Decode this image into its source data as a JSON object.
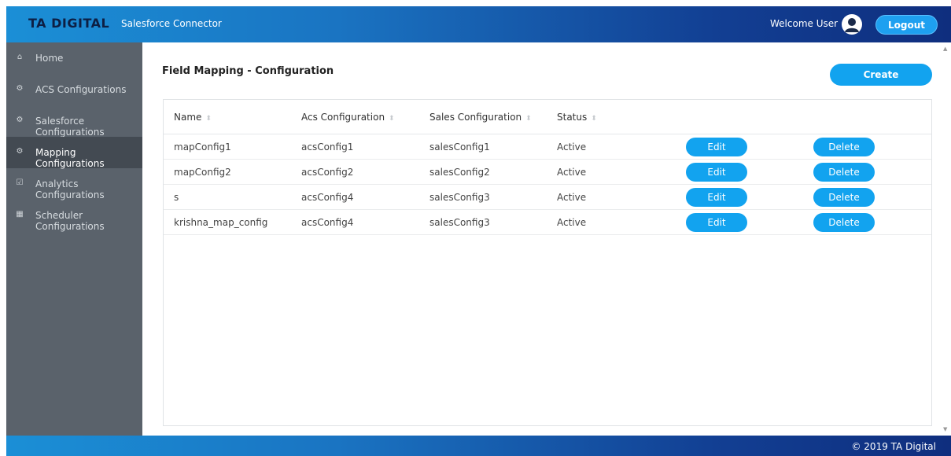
{
  "header": {
    "brand": "TA DIGITAL",
    "app_title": "Salesforce Connector",
    "welcome": "Welcome User",
    "logout_label": "Logout"
  },
  "sidebar": {
    "items": [
      {
        "label": "Home",
        "icon": "home-icon"
      },
      {
        "label": "ACS Configurations",
        "icon": "cogs-icon"
      },
      {
        "label": "Salesforce Configurations",
        "icon": "cogs-icon"
      },
      {
        "label": "Mapping Configurations",
        "icon": "cogs-icon",
        "active": true
      },
      {
        "label": "Analytics Configurations",
        "icon": "checkbox-icon"
      },
      {
        "label": "Scheduler Configurations",
        "icon": "calendar-icon"
      }
    ]
  },
  "main": {
    "title": "Field Mapping - Configuration",
    "create_label": "Create",
    "table": {
      "columns": [
        "Name",
        "Acs Configuration",
        "Sales Configuration",
        "Status"
      ],
      "edit_label": "Edit",
      "delete_label": "Delete",
      "rows": [
        {
          "name": "mapConfig1",
          "acs": "acsConfig1",
          "sales": "salesConfig1",
          "status": "Active"
        },
        {
          "name": "mapConfig2",
          "acs": "acsConfig2",
          "sales": "salesConfig2",
          "status": "Active"
        },
        {
          "name": "s",
          "acs": "acsConfig4",
          "sales": "salesConfig3",
          "status": "Active"
        },
        {
          "name": "krishna_map_config",
          "acs": "acsConfig4",
          "sales": "salesConfig3",
          "status": "Active"
        }
      ]
    }
  },
  "footer": {
    "copyright": "© 2019 TA Digital"
  },
  "colors": {
    "accent": "#12a3ef",
    "sidebar": "#5a626b",
    "sidebar_active": "#434a52",
    "header_start": "#1b8fd6",
    "header_end": "#0f2e7e"
  }
}
